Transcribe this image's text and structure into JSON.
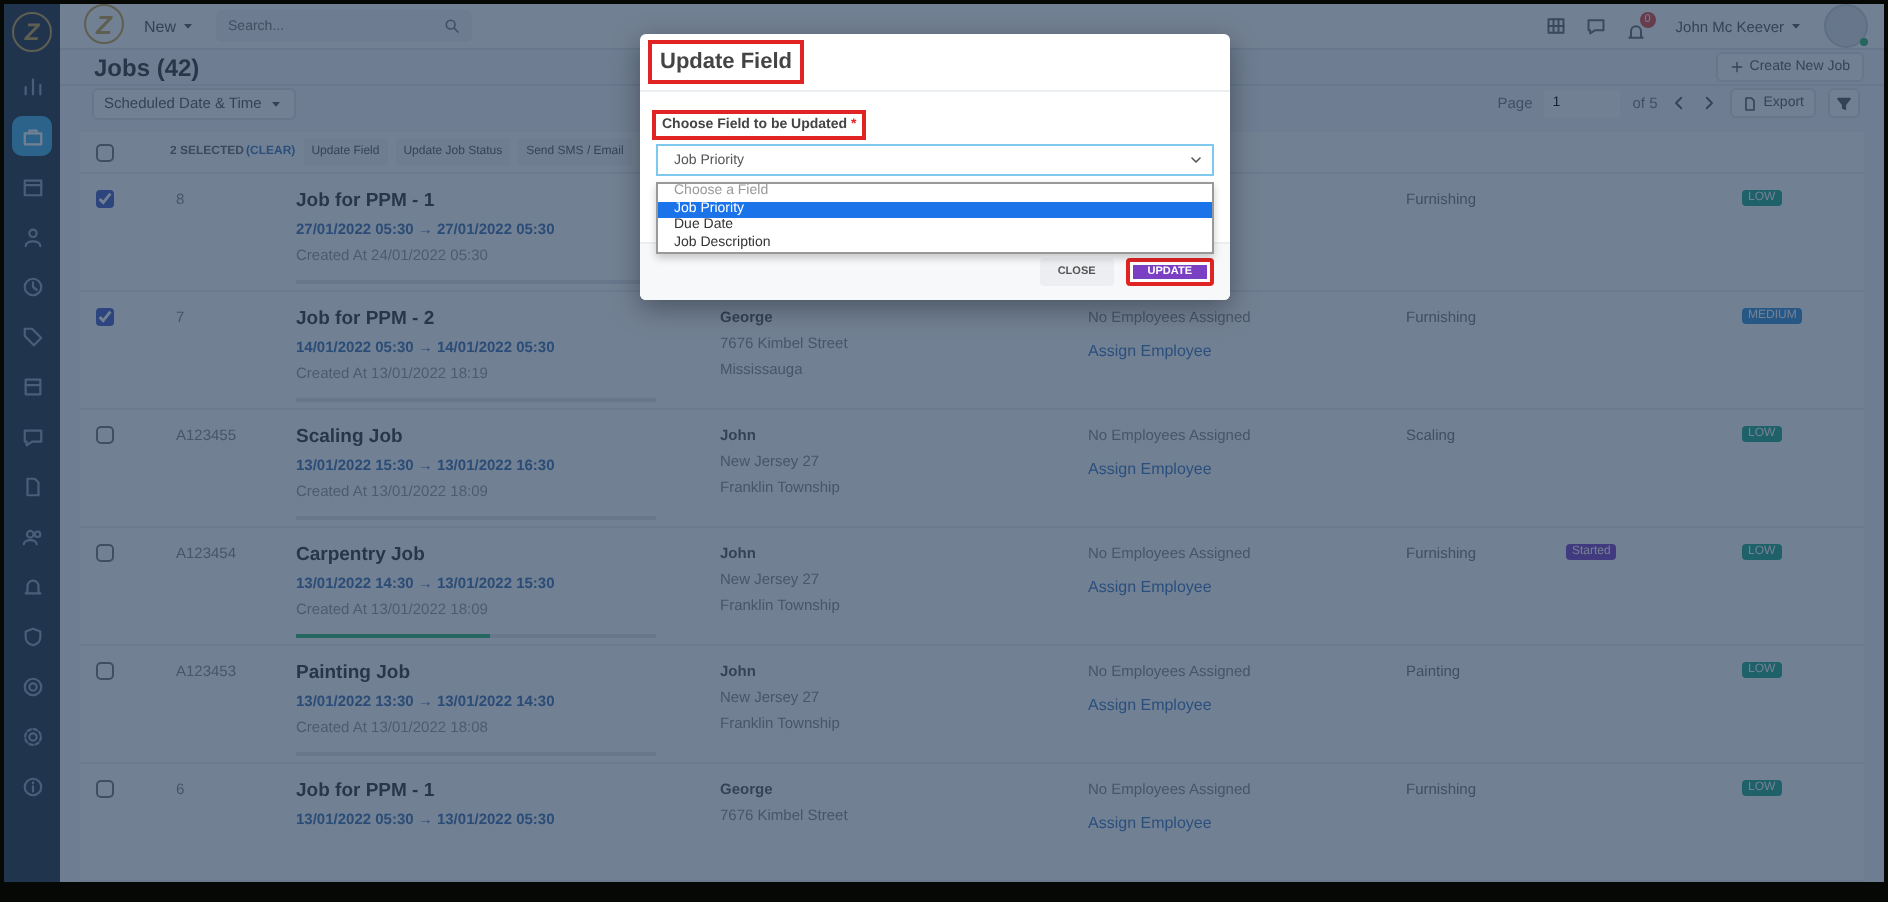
{
  "sidebar": {
    "logo": "Z",
    "items": [
      {
        "kind": "chart",
        "selected": false
      },
      {
        "kind": "briefcase",
        "selected": true
      },
      {
        "kind": "calendar",
        "selected": false
      },
      {
        "kind": "person",
        "selected": false
      },
      {
        "kind": "clock",
        "selected": false
      },
      {
        "kind": "tag",
        "selected": false
      },
      {
        "kind": "box",
        "selected": false
      },
      {
        "kind": "chat",
        "selected": false
      },
      {
        "kind": "document",
        "selected": false
      },
      {
        "kind": "people",
        "selected": false
      },
      {
        "kind": "bell",
        "selected": false
      },
      {
        "kind": "shield",
        "selected": false
      },
      {
        "kind": "coin",
        "selected": false
      },
      {
        "kind": "gear",
        "selected": false
      },
      {
        "kind": "info",
        "selected": false
      }
    ]
  },
  "topbar": {
    "logo": "Z",
    "new_menu": "New",
    "search": {
      "placeholder": "Search..."
    },
    "notification_count": "0",
    "user": "John Mc Keever"
  },
  "header": {
    "title": "Jobs (42)",
    "create_button": "Create New Job"
  },
  "filters": {
    "sort": "Scheduled Date & Time",
    "page_label": "Page",
    "page": "1",
    "page_total": "of 5",
    "export": "Export"
  },
  "bulk_bar": {
    "checked": false,
    "selected_count": "2 SELECTED",
    "clear": "(CLEAR)",
    "actions": [
      "Update Field",
      "Update Job Status",
      "Send SMS / Email"
    ]
  },
  "rows": [
    {
      "checked": true,
      "id": "8",
      "title": "Job for PPM - 1",
      "schedule": "27/01/2022 05:30 → 27/01/2022 05:30",
      "created": "Created At 24/01/2022 05:30",
      "category": "Furnishing",
      "priority": {
        "label": "LOW",
        "kind": "low"
      }
    },
    {
      "checked": true,
      "id": "7",
      "title": "Job for PPM - 2",
      "schedule": "14/01/2022 05:30 → 14/01/2022 05:30",
      "created": "Created At 13/01/2022 18:19",
      "client": {
        "name": "George",
        "lines": [
          "7676 Kimbel Street",
          "Mississauga"
        ]
      },
      "employees": "No Employees Assigned",
      "assign": "Assign Employee",
      "category": "Furnishing",
      "priority": {
        "label": "MEDIUM",
        "kind": "medium"
      }
    },
    {
      "checked": false,
      "id": "A123455",
      "title": "Scaling Job",
      "schedule": "13/01/2022 15:30 → 13/01/2022 16:30",
      "created": "Created At 13/01/2022 18:09",
      "client": {
        "name": "John",
        "lines": [
          "New Jersey 27",
          "Franklin Township"
        ]
      },
      "employees": "No Employees Assigned",
      "assign": "Assign Employee",
      "category": "Scaling",
      "priority": {
        "label": "LOW",
        "kind": "low"
      }
    },
    {
      "checked": false,
      "id": "A123454",
      "title": "Carpentry Job",
      "schedule": "13/01/2022 14:30 → 13/01/2022 15:30",
      "created": "Created At 13/01/2022 18:09",
      "level": 0.54,
      "client": {
        "name": "John",
        "lines": [
          "New Jersey 27",
          "Franklin Township"
        ]
      },
      "employees": "No Employees Assigned",
      "assign": "Assign Employee",
      "category": "Furnishing",
      "status": "Started",
      "priority": {
        "label": "LOW",
        "kind": "low"
      }
    },
    {
      "checked": false,
      "id": "A123453",
      "title": "Painting Job",
      "schedule": "13/01/2022 13:30 → 13/01/2022 14:30",
      "created": "Created At 13/01/2022 18:08",
      "client": {
        "name": "John",
        "lines": [
          "New Jersey 27",
          "Franklin Township"
        ]
      },
      "employees": "No Employees Assigned",
      "assign": "Assign Employee",
      "category": "Painting",
      "priority": {
        "label": "LOW",
        "kind": "low"
      }
    },
    {
      "checked": false,
      "id": "6",
      "title": "Job for PPM - 1",
      "schedule": "13/01/2022 05:30 → 13/01/2022 05:30",
      "client": {
        "name": "George",
        "lines": [
          "7676 Kimbel Street"
        ]
      },
      "employees": "No Employees Assigned",
      "assign": "Assign Employee",
      "category": "Furnishing",
      "priority": {
        "label": "LOW",
        "kind": "low"
      }
    }
  ],
  "dialog": {
    "title": "Update Field",
    "title_highlighted": true,
    "field_label": "Choose Field to be Updated",
    "required_mark": "*",
    "label_highlighted": true,
    "value": "Job Priority",
    "options": [
      {
        "label": "Choose a Field",
        "kind": "hint",
        "selected": false
      },
      {
        "label": "Job Priority",
        "kind": "option",
        "selected": true
      },
      {
        "label": "Due Date",
        "kind": "option",
        "selected": false
      },
      {
        "label": "Job Description",
        "kind": "option",
        "selected": false
      }
    ],
    "buttons": [
      {
        "label": "CLOSE",
        "kind": "secondary",
        "highlighted": false
      },
      {
        "label": "UPDATE",
        "kind": "primary",
        "highlighted": true
      }
    ]
  }
}
